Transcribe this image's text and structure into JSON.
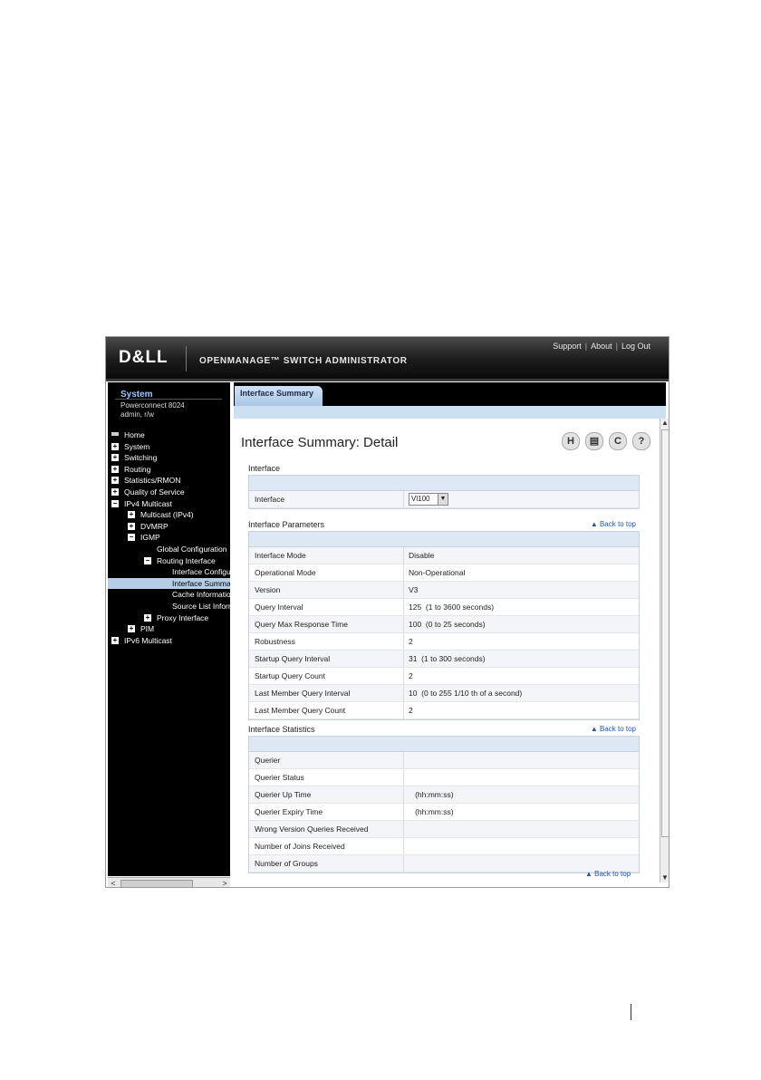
{
  "header": {
    "logo": "D&LL",
    "product": "OPENMANAGE™ SWITCH ADMINISTRATOR",
    "links": [
      "Support",
      "About",
      "Log Out"
    ]
  },
  "sidebar": {
    "system_title": "System",
    "device": "Powerconnect 8024",
    "user": "admin, r/w",
    "tree": [
      {
        "label": "Home",
        "level": 0,
        "icon": "home"
      },
      {
        "label": "System",
        "level": 0,
        "icon": "plus"
      },
      {
        "label": "Switching",
        "level": 0,
        "icon": "plus"
      },
      {
        "label": "Routing",
        "level": 0,
        "icon": "plus"
      },
      {
        "label": "Statistics/RMON",
        "level": 0,
        "icon": "plus"
      },
      {
        "label": "Quality of Service",
        "level": 0,
        "icon": "plus"
      },
      {
        "label": "IPv4 Multicast",
        "level": 0,
        "icon": "minus"
      },
      {
        "label": "Multicast (IPv4)",
        "level": 1,
        "icon": "plus"
      },
      {
        "label": "DVMRP",
        "level": 1,
        "icon": "plus"
      },
      {
        "label": "IGMP",
        "level": 1,
        "icon": "minus"
      },
      {
        "label": "Global Configuration",
        "level": 2,
        "icon": "none"
      },
      {
        "label": "Routing Interface",
        "level": 2,
        "icon": "minus"
      },
      {
        "label": "Interface Configuration",
        "level": 3,
        "icon": "none"
      },
      {
        "label": "Interface Summary",
        "level": 3,
        "icon": "none",
        "selected": true
      },
      {
        "label": "Cache Information",
        "level": 3,
        "icon": "none"
      },
      {
        "label": "Source List Information",
        "level": 3,
        "icon": "none"
      },
      {
        "label": "Proxy Interface",
        "level": 2,
        "icon": "plus"
      },
      {
        "label": "PIM",
        "level": 1,
        "icon": "plus"
      },
      {
        "label": "IPv6 Multicast",
        "level": 0,
        "icon": "plus"
      }
    ]
  },
  "tab": "Interface Summary",
  "page_title": "Interface Summary: Detail",
  "back_to_top": "Back to top",
  "interface_section": {
    "title": "Interface",
    "label": "Interface",
    "value": "Vl100"
  },
  "parameters": {
    "title": "Interface Parameters",
    "rows": [
      {
        "k": "Interface Mode",
        "v": "Disable"
      },
      {
        "k": "Operational Mode",
        "v": "Non-Operational"
      },
      {
        "k": "Version",
        "v": "V3"
      },
      {
        "k": "Query Interval",
        "v": "125  (1 to 3600 seconds)"
      },
      {
        "k": "Query Max Response Time",
        "v": "100  (0 to 25 seconds)"
      },
      {
        "k": "Robustness",
        "v": "2"
      },
      {
        "k": "Startup Query Interval",
        "v": "31  (1 to 300 seconds)"
      },
      {
        "k": "Startup Query Count",
        "v": "2"
      },
      {
        "k": "Last Member Query Interval",
        "v": "10  (0 to 255 1/10 th of a second)"
      },
      {
        "k": "Last Member Query Count",
        "v": "2"
      }
    ]
  },
  "statistics": {
    "title": "Interface Statistics",
    "rows": [
      {
        "k": "Querier",
        "v": ""
      },
      {
        "k": "Querier Status",
        "v": ""
      },
      {
        "k": "Querier Up Time",
        "v": "   (hh:mm:ss)"
      },
      {
        "k": "Querier Expiry Time",
        "v": "   (hh:mm:ss)"
      },
      {
        "k": "Wrong Version Queries Received",
        "v": ""
      },
      {
        "k": "Number of Joins Received",
        "v": ""
      },
      {
        "k": "Number of Groups",
        "v": ""
      }
    ]
  }
}
